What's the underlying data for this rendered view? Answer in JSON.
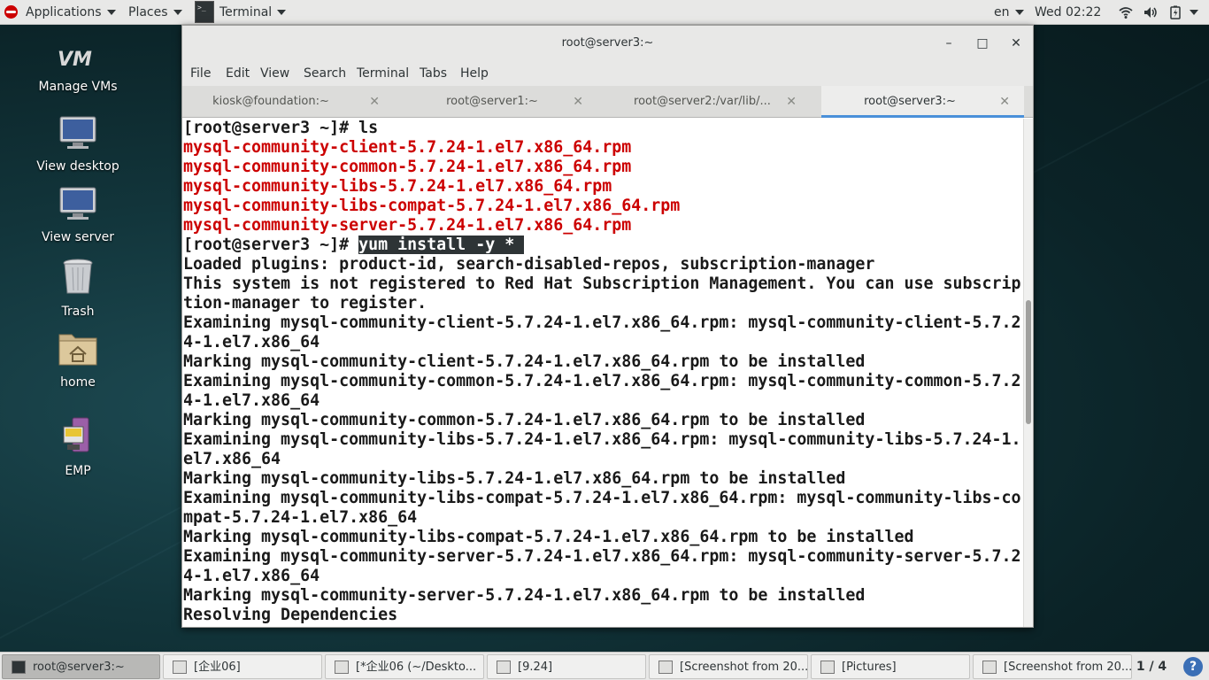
{
  "topbar": {
    "applications": "Applications",
    "places": "Places",
    "terminal": "Terminal",
    "lang": "en",
    "clock": "Wed 02:22"
  },
  "desktop": {
    "icons": [
      {
        "label": "Manage VMs",
        "icon": "vm-icon"
      },
      {
        "label": "View desktop",
        "icon": "monitor-icon"
      },
      {
        "label": "View server",
        "icon": "monitor-icon"
      },
      {
        "label": "Trash",
        "icon": "trash-icon"
      },
      {
        "label": "home",
        "icon": "home-folder-icon"
      },
      {
        "label": "EMP",
        "icon": "emp-icon"
      }
    ]
  },
  "window": {
    "title": "root@server3:~",
    "buttons": {
      "minimize": "–",
      "maximize": "□",
      "close": "✕"
    },
    "menu": [
      "File",
      "Edit",
      "View",
      "Search",
      "Terminal",
      "Tabs",
      "Help"
    ],
    "tabs": [
      {
        "label": "kiosk@foundation:~",
        "close": "✕"
      },
      {
        "label": "root@server1:~",
        "close": "✕"
      },
      {
        "label": "root@server2:/var/lib/...",
        "close": "✕"
      },
      {
        "label": "root@server3:~",
        "close": "✕"
      }
    ],
    "active_tab": 3
  },
  "terminal": {
    "lines": [
      {
        "t": "[root@server3 ~]# ls",
        "style": "normal"
      },
      {
        "t": "mysql-community-client-5.7.24-1.el7.x86_64.rpm",
        "style": "red"
      },
      {
        "t": "mysql-community-common-5.7.24-1.el7.x86_64.rpm",
        "style": "red"
      },
      {
        "t": "mysql-community-libs-5.7.24-1.el7.x86_64.rpm",
        "style": "red"
      },
      {
        "t": "mysql-community-libs-compat-5.7.24-1.el7.x86_64.rpm",
        "style": "red"
      },
      {
        "t": "mysql-community-server-5.7.24-1.el7.x86_64.rpm",
        "style": "red"
      },
      {
        "t": "[root@server3 ~]# ",
        "sel": "yum install -y * ",
        "style": "cmd"
      },
      {
        "t": "Loaded plugins: product-id, search-disabled-repos, subscription-manager",
        "style": "normal"
      },
      {
        "t": "This system is not registered to Red Hat Subscription Management. You can use subscrip",
        "style": "normal"
      },
      {
        "t": "tion-manager to register.",
        "style": "normal"
      },
      {
        "t": "Examining mysql-community-client-5.7.24-1.el7.x86_64.rpm: mysql-community-client-5.7.2",
        "style": "normal"
      },
      {
        "t": "4-1.el7.x86_64",
        "style": "normal"
      },
      {
        "t": "Marking mysql-community-client-5.7.24-1.el7.x86_64.rpm to be installed",
        "style": "normal"
      },
      {
        "t": "Examining mysql-community-common-5.7.24-1.el7.x86_64.rpm: mysql-community-common-5.7.2",
        "style": "normal"
      },
      {
        "t": "4-1.el7.x86_64",
        "style": "normal"
      },
      {
        "t": "Marking mysql-community-common-5.7.24-1.el7.x86_64.rpm to be installed",
        "style": "normal"
      },
      {
        "t": "Examining mysql-community-libs-5.7.24-1.el7.x86_64.rpm: mysql-community-libs-5.7.24-1.",
        "style": "normal"
      },
      {
        "t": "el7.x86_64",
        "style": "normal"
      },
      {
        "t": "Marking mysql-community-libs-5.7.24-1.el7.x86_64.rpm to be installed",
        "style": "normal"
      },
      {
        "t": "Examining mysql-community-libs-compat-5.7.24-1.el7.x86_64.rpm: mysql-community-libs-co",
        "style": "normal"
      },
      {
        "t": "mpat-5.7.24-1.el7.x86_64",
        "style": "normal"
      },
      {
        "t": "Marking mysql-community-libs-compat-5.7.24-1.el7.x86_64.rpm to be installed",
        "style": "normal"
      },
      {
        "t": "Examining mysql-community-server-5.7.24-1.el7.x86_64.rpm: mysql-community-server-5.7.2",
        "style": "normal"
      },
      {
        "t": "4-1.el7.x86_64",
        "style": "normal"
      },
      {
        "t": "Marking mysql-community-server-5.7.24-1.el7.x86_64.rpm to be installed",
        "style": "normal"
      },
      {
        "t": "Resolving Dependencies",
        "style": "normal"
      }
    ]
  },
  "taskbar": {
    "tasks": [
      {
        "label": "root@server3:~",
        "icon": "terminal-icon",
        "active": true
      },
      {
        "label": "[企业06]",
        "icon": "folder-icon",
        "active": false
      },
      {
        "label": "[*企业06 (~/Deskto...",
        "icon": "text-editor-icon",
        "active": false
      },
      {
        "label": "[9.24]",
        "icon": "folder-icon",
        "active": false
      },
      {
        "label": "[Screenshot from 20...",
        "icon": "image-viewer-icon",
        "active": false
      },
      {
        "label": "[Pictures]",
        "icon": "folder-icon",
        "active": false
      },
      {
        "label": "[Screenshot from 20...",
        "icon": "image-viewer-icon",
        "active": false
      }
    ],
    "workspace": "1 / 4",
    "help": "?"
  },
  "colors": {
    "panel": "#e8e8e7",
    "terminal_red": "#cc0000",
    "tab_accent": "#4a90d9",
    "desktop": "#12353b"
  }
}
